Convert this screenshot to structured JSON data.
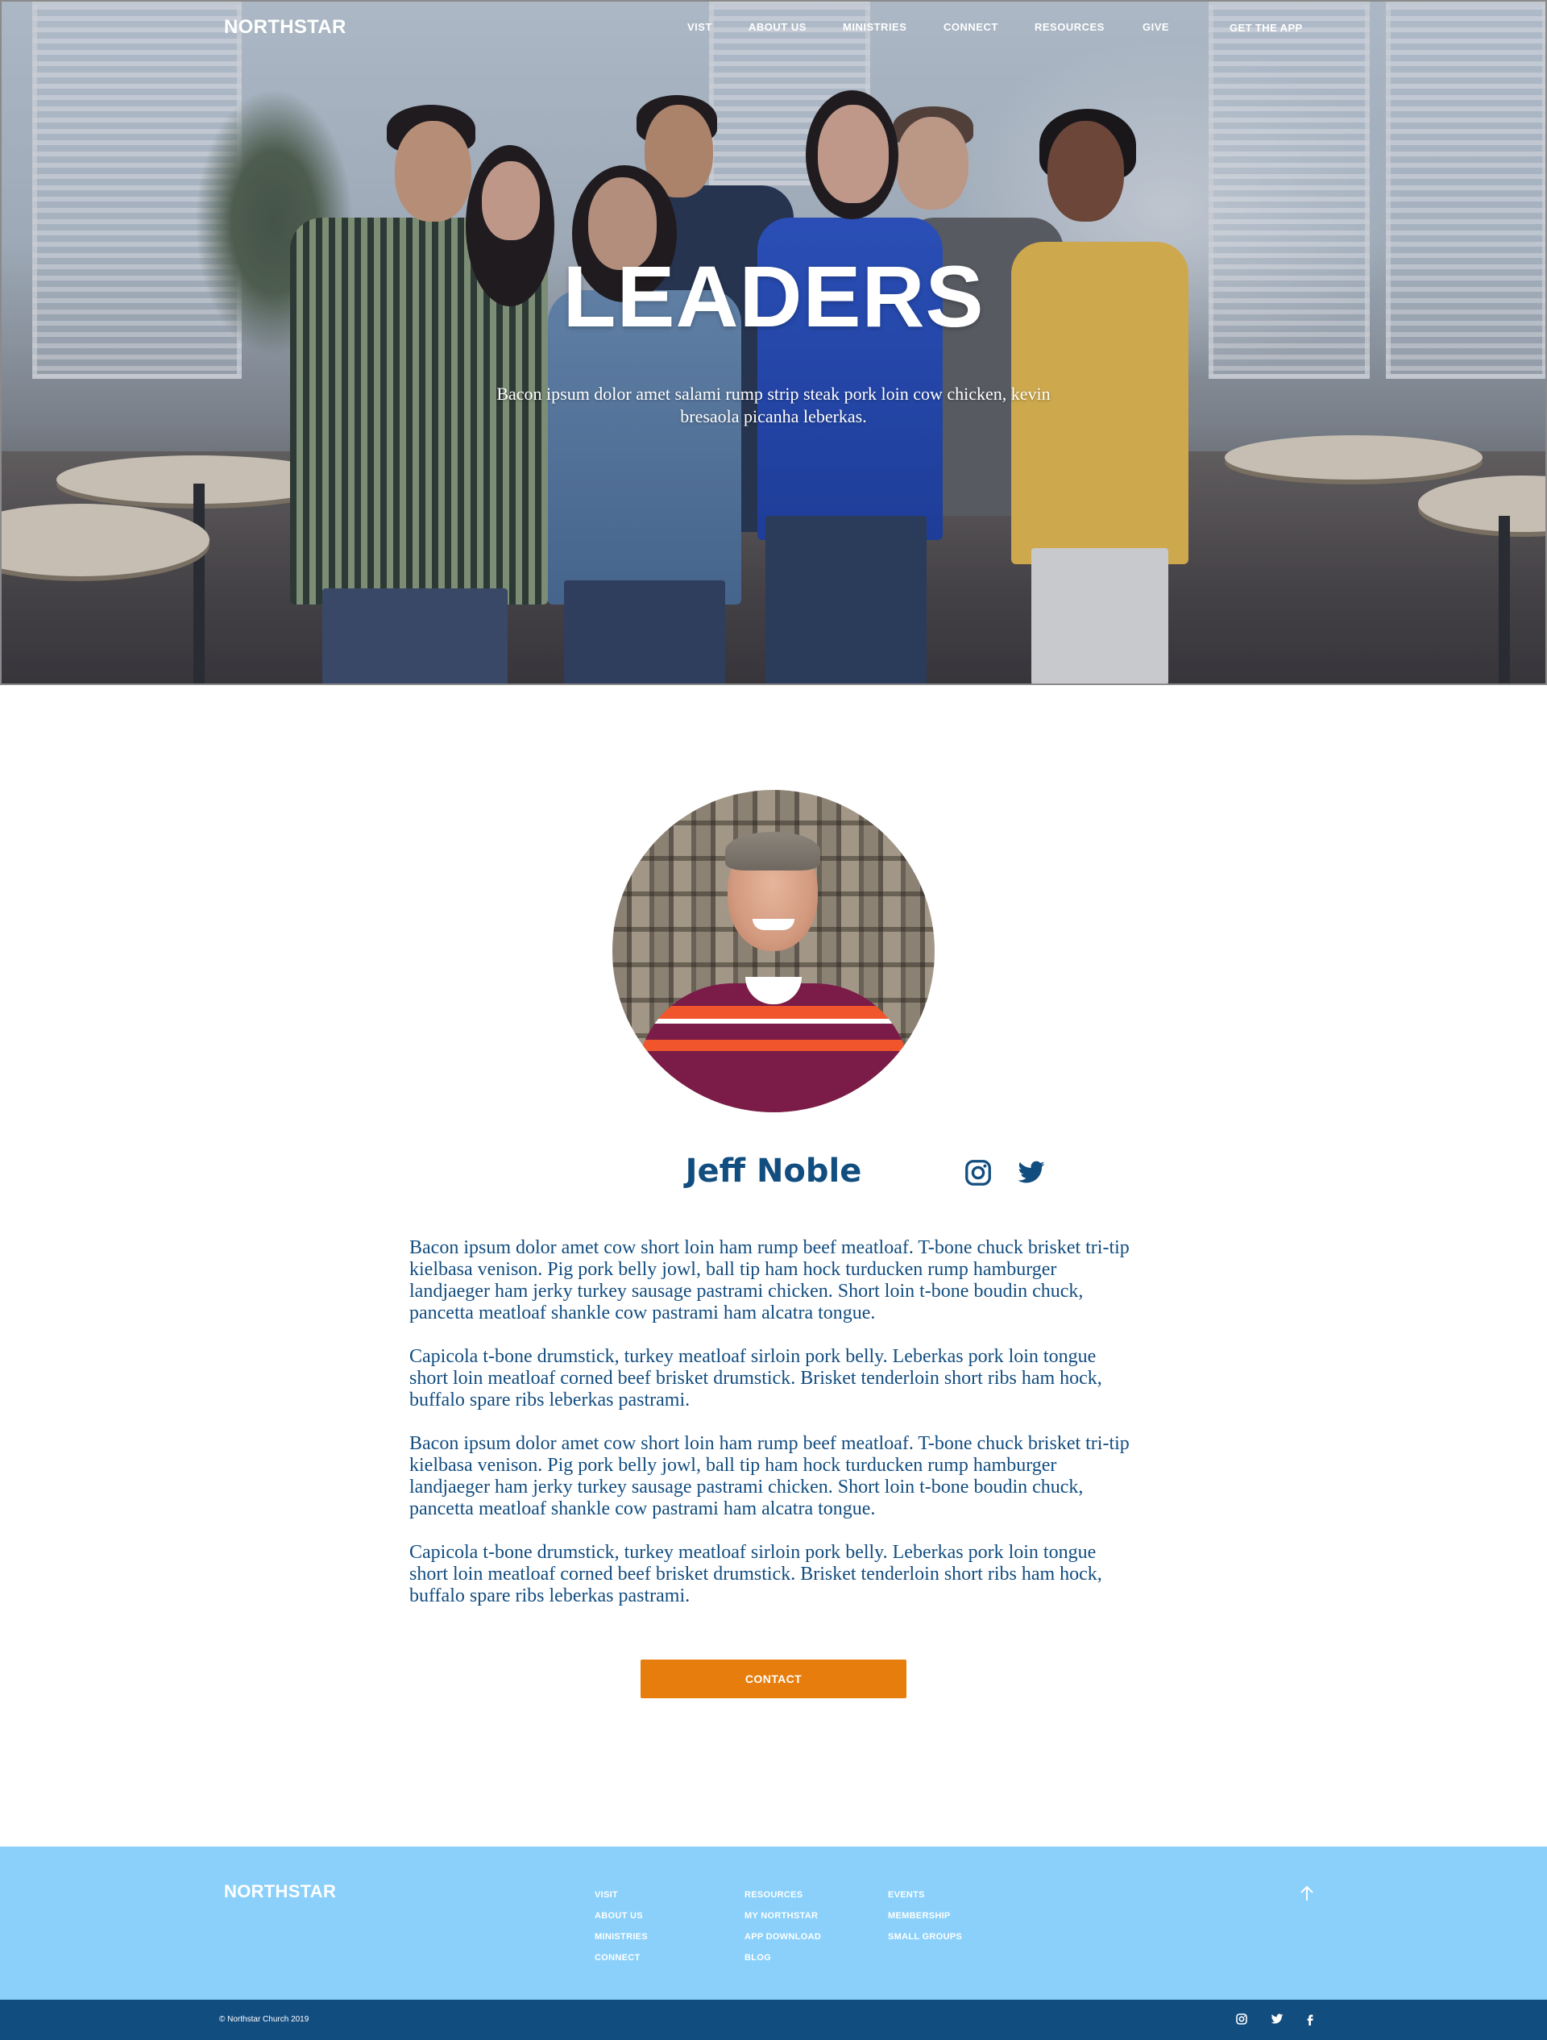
{
  "nav": {
    "brand": "NORTHSTAR",
    "items": [
      "VIST",
      "ABOUT US",
      "MINISTRIES",
      "CONNECT",
      "RESOURCES",
      "GIVE"
    ],
    "cta": "GET THE APP"
  },
  "hero": {
    "title": "LEADERS",
    "subtitle": "Bacon ipsum dolor amet salami rump strip steak pork loin cow chicken, kevin bresaola picanha leberkas."
  },
  "profile": {
    "name": "Jeff Noble",
    "social_icons": [
      "instagram-icon",
      "twitter-icon"
    ],
    "bio": [
      "Bacon ipsum dolor amet cow short loin ham rump beef meatloaf. T-bone chuck brisket tri-tip kielbasa venison. Pig pork belly jowl, ball tip ham hock turducken rump hamburger landjaeger ham jerky turkey sausage pastrami chicken. Short loin t-bone boudin chuck, pancetta meatloaf shankle cow pastrami ham alcatra tongue.",
      "Capicola t-bone drumstick, turkey meatloaf sirloin pork belly. Leberkas pork loin tongue short loin meatloaf corned beef brisket drumstick. Brisket tenderloin short ribs ham hock, buffalo spare ribs leberkas pastrami.",
      "Bacon ipsum dolor amet cow short loin ham rump beef meatloaf. T-bone chuck brisket tri-tip kielbasa venison. Pig pork belly jowl, ball tip ham hock turducken rump hamburger landjaeger ham jerky turkey sausage pastrami chicken. Short loin t-bone boudin chuck, pancetta meatloaf shankle cow pastrami ham alcatra tongue.",
      "Capicola t-bone drumstick, turkey meatloaf sirloin pork belly. Leberkas pork loin tongue short loin meatloaf corned beef brisket drumstick. Brisket tenderloin short ribs ham hock, buffalo spare ribs leberkas pastrami."
    ],
    "contact_label": "CONTACT"
  },
  "footer": {
    "brand": "NORTHSTAR",
    "col1": [
      "VISIT",
      "ABOUT US",
      "MINISTRIES",
      "CONNECT"
    ],
    "col2": [
      "RESOURCES",
      "MY NORTHSTAR",
      "APP DOWNLOAD",
      "BLOG"
    ],
    "col3": [
      "EVENTS",
      "MEMBERSHIP",
      "SMALL GROUPS"
    ],
    "copyright": "© Northstar Church 2019",
    "social_icons": [
      "instagram-icon",
      "twitter-icon",
      "facebook-icon"
    ]
  },
  "colors": {
    "primary_blue": "#124d80",
    "footer_light_blue": "#8ad0fb",
    "accent_orange": "#e77d0c"
  }
}
